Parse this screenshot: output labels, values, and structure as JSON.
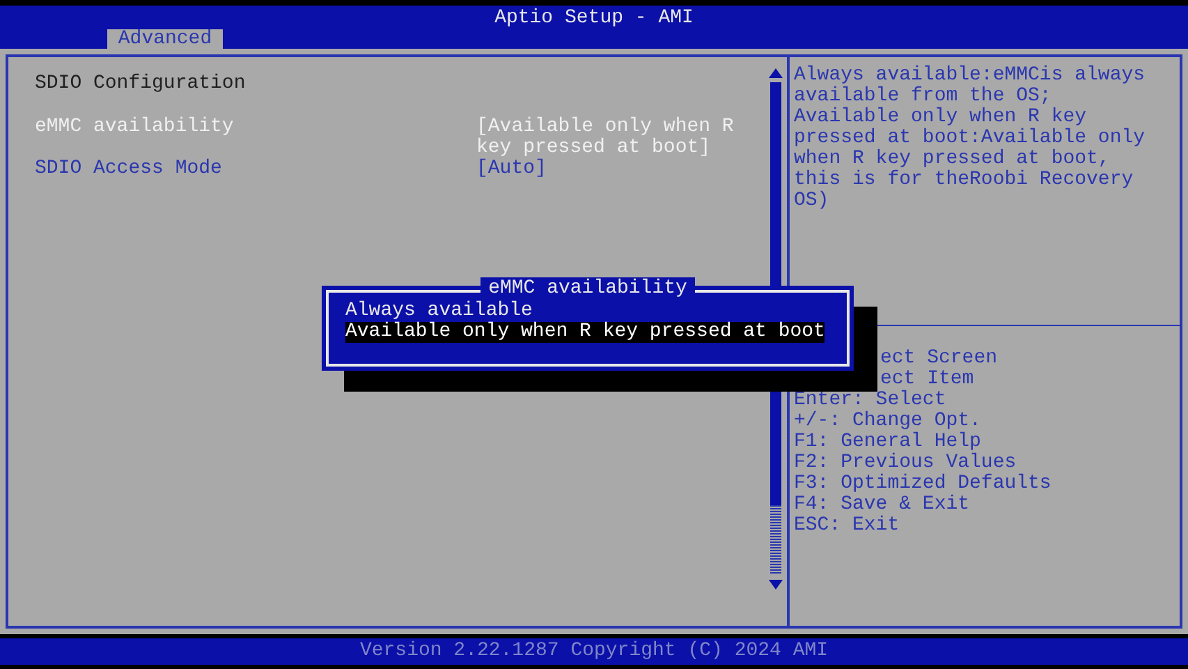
{
  "window": {
    "title": "Aptio Setup - AMI"
  },
  "tabs": [
    {
      "label": "Advanced",
      "selected": true
    }
  ],
  "left_panel": {
    "heading": "SDIO Configuration",
    "items": [
      {
        "label": "eMMC availability",
        "value": "[Available only when R key pressed at boot]",
        "selected": true
      },
      {
        "label": "SDIO Access Mode",
        "value": "[Auto]",
        "selected": false
      }
    ]
  },
  "help_text": "Always available:eMMCis always available from the OS; Available only when R key pressed at boot:Available only when R key pressed at boot, this is for theRoobi Recovery OS)",
  "key_help": [
    {
      "text": "ect Screen",
      "kind": "partial"
    },
    {
      "text": "ect Item",
      "kind": "partial"
    },
    {
      "text": "Enter: Select",
      "kind": "full"
    },
    {
      "text": "+/-: Change Opt.",
      "kind": "full"
    },
    {
      "text": "F1: General Help",
      "kind": "full"
    },
    {
      "text": "F2: Previous Values",
      "kind": "full"
    },
    {
      "text": "F3: Optimized Defaults",
      "kind": "full"
    },
    {
      "text": "F4: Save & Exit",
      "kind": "full"
    },
    {
      "text": "ESC: Exit",
      "kind": "full"
    }
  ],
  "popup": {
    "title": "eMMC availability",
    "options": [
      {
        "label": "Always available",
        "selected": false
      },
      {
        "label": "Available only when R key pressed at boot",
        "selected": true
      }
    ]
  },
  "status_bar": "Version 2.22.1287 Copyright (C) 2024 AMI"
}
